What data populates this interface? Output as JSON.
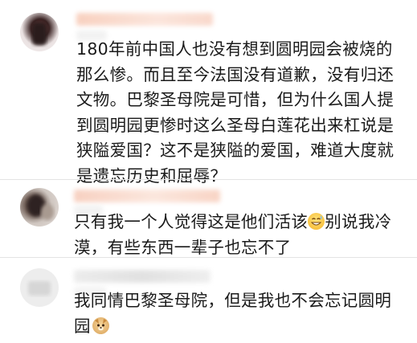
{
  "comments": [
    {
      "text": "180年前中国人也没有想到圆明园会被烧的那么惨。而且至今法国没有道歉，没有归还文物。巴黎圣母院是可惜，但为什么国人提到圆明园更惨时这么圣母白莲花出来杠说是狭隘爱国？这不是狭隘的爱国，难道大度就是遗忘历史和屈辱？"
    },
    {
      "text_before": "只有我一个人觉得这是他们活该",
      "emoji": "grinning-sweat-emoji",
      "text_after": "别说我冷漠，有些东西一辈子也忘不了"
    },
    {
      "text": "我同情巴黎圣母院，但是我也不会忘记圆明园",
      "emoji": "doge-emoji"
    }
  ]
}
